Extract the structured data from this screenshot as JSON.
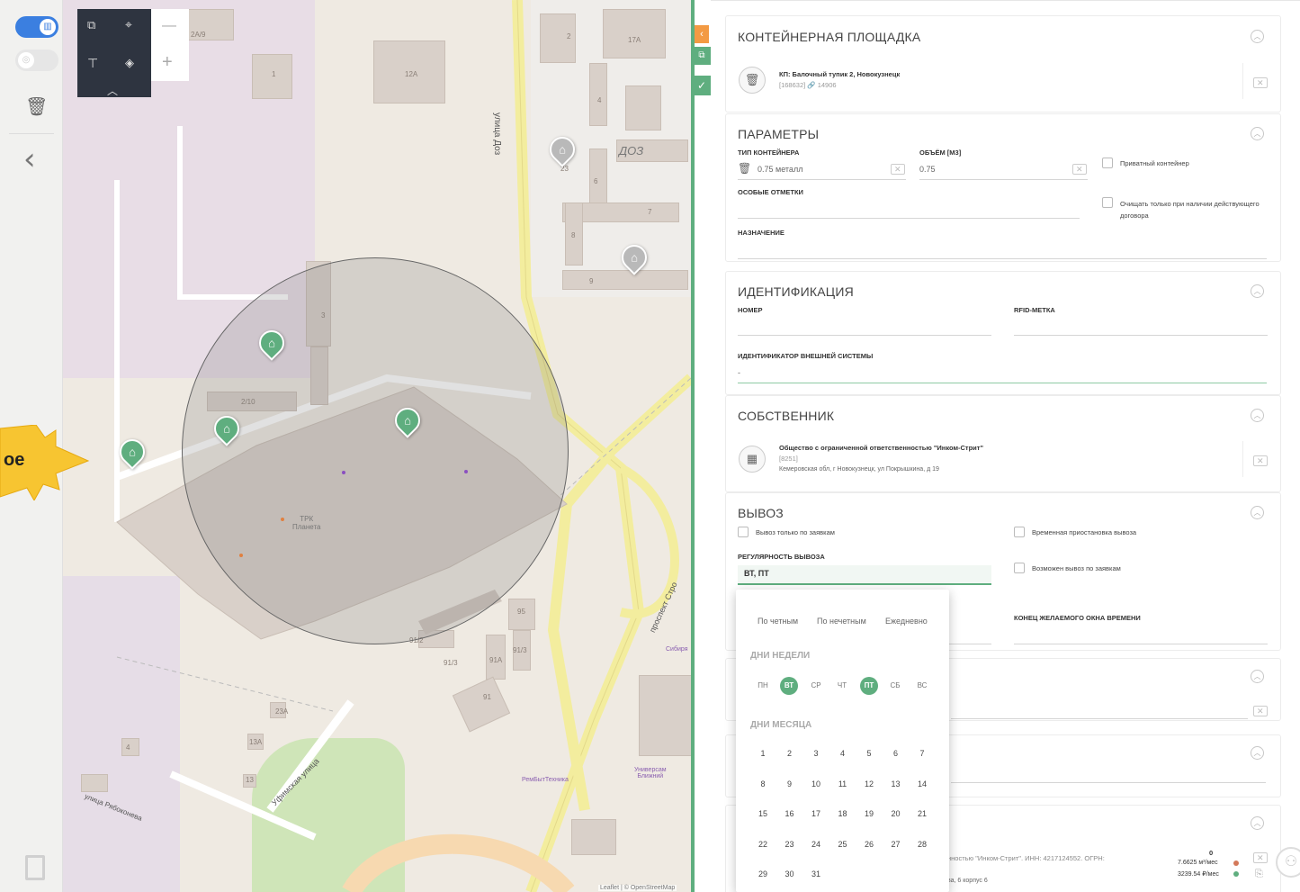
{
  "map_controls": {
    "plus": "+",
    "minus": "—"
  },
  "map": {
    "street_doz_vertical": "улица Доз",
    "street_doz_label": "ДОЗ",
    "street_stroiteley": "проспект Стро",
    "street_ufimskaya": "Уфимская улица",
    "street_rybokoneva": "улица Рябоконева",
    "trk_name": "ТРК\nПланета",
    "shop_remb": "РемБытТехника",
    "shop_univ": "Универсам\nБлижний",
    "sibir": "Сибиря",
    "attribution": "Leaflet | © OpenStreetMap",
    "house_numbers": [
      "2А/9",
      "1",
      "12А",
      "2",
      "17А",
      "4",
      "6",
      "23",
      "7",
      "8",
      "9",
      "3",
      "2/10",
      "95",
      "91/2",
      "91/3",
      "91А",
      "91/3",
      "91",
      "23А",
      "13А",
      "4",
      "13"
    ]
  },
  "badge": {
    "text": "ое"
  },
  "container_site": {
    "title": "КОНТЕЙНЕРНАЯ ПЛОЩАДКА",
    "name": "КП: Балочный тупик 2, Новокузнецк",
    "meta": "[168632] 🔗 14906"
  },
  "params": {
    "title": "ПАРАМЕТРЫ",
    "type_label": "ТИП КОНТЕЙНЕРА",
    "type_value": "0.75 металл",
    "volume_label": "ОБЪЁМ [М3]",
    "volume_value": "0.75",
    "private_label": "Приватный контейнер",
    "notes_label": "ОСОБЫЕ ОТМЕТКИ",
    "clean_label_1": "Очищать только при наличии действующего",
    "clean_label_2": "договора",
    "purpose_label": "НАЗНАЧЕНИЕ"
  },
  "ident": {
    "title": "ИДЕНТИФИКАЦИЯ",
    "number_label": "НОМЕР",
    "rfid_label": "RFID-МЕТКА",
    "ext_label": "ИДЕНТИФИКАТОР ВНЕШНЕЙ СИСТЕМЫ",
    "ext_value": "-"
  },
  "owner": {
    "title": "СОБСТВЕННИК",
    "name": "Общество с ограниченной ответственностью \"Инком-Стрит\"",
    "id": "[8251]",
    "address": "Кемеровская обл, г Новокузнецк, ул Покрышкина, д 19"
  },
  "removal": {
    "title": "ВЫВОЗ",
    "only_requests": "Вывоз только по заявкам",
    "suspend": "Временная приостановка вывоза",
    "regularity_label": "РЕГУЛЯРНОСТЬ ВЫВОЗА",
    "regularity_value": "ВТ, ПТ",
    "possible_requests": "Возможен вывоз по заявкам",
    "window_end_label": "КОНЕЦ ЖЕЛАЕМОГО ОКНА ВРЕМЕНИ"
  },
  "dropdown": {
    "even": "По четным",
    "odd": "По нечетным",
    "daily": "Ежедневно",
    "weekdays_header": "ДНИ НЕДЕЛИ",
    "weekdays": [
      "ПН",
      "ВТ",
      "СР",
      "ЧТ",
      "ПТ",
      "СБ",
      "ВС"
    ],
    "selected_weekdays": [
      "ВТ",
      "ПТ"
    ],
    "monthdays_header": "ДНИ МЕСЯЦА",
    "monthdays": [
      "1",
      "2",
      "3",
      "4",
      "5",
      "6",
      "7",
      "8",
      "9",
      "10",
      "11",
      "12",
      "13",
      "14",
      "15",
      "16",
      "17",
      "18",
      "19",
      "20",
      "21",
      "22",
      "23",
      "24",
      "25",
      "26",
      "27",
      "28",
      "29",
      "30",
      "31"
    ]
  },
  "bottom": {
    "org_text": "нностью \"Инком-Стрит\". ИНН: 4217124552. ОГРН:",
    "addr_text": "ва, 6 корпус 6",
    "zero": "0",
    "area_value": "7.6625 м³/мес",
    "price_value": "3239.54 ₽/мес"
  },
  "colors": {
    "accent": "#5fae7f",
    "orange": "#f39a43",
    "badge": "#f7c531"
  }
}
